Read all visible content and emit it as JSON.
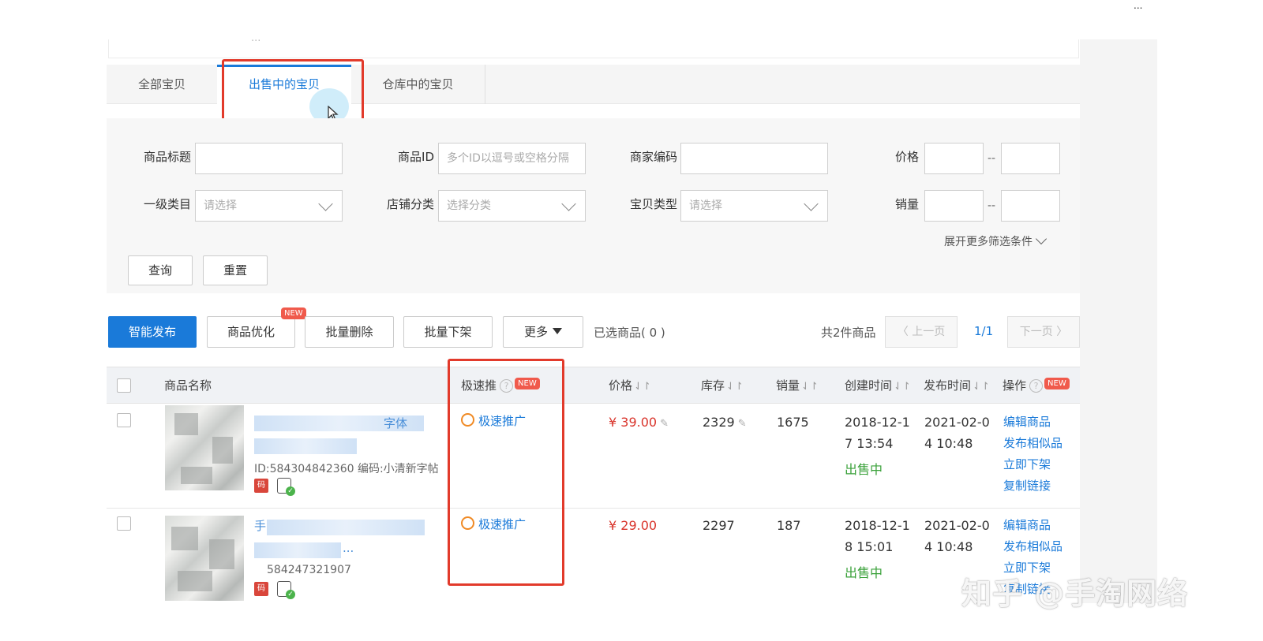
{
  "top": {
    "faint_text": "...",
    "corner_text": "..."
  },
  "tabs": [
    {
      "label": "全部宝贝"
    },
    {
      "label": "出售中的宝贝"
    },
    {
      "label": "仓库中的宝贝"
    }
  ],
  "filters": {
    "title_label": "商品标题",
    "id_label": "商品ID",
    "id_placeholder": "多个ID以逗号或空格分隔",
    "code_label": "商家编码",
    "price_label": "价格",
    "category_label": "一级类目",
    "category_value": "请选择",
    "shop_cat_label": "店铺分类",
    "shop_cat_value": "选择分类",
    "type_label": "宝贝类型",
    "type_value": "请选择",
    "sales_label": "销量",
    "range_sep": "--",
    "expand_label": "展开更多筛选条件",
    "query_button": "查询",
    "reset_button": "重置"
  },
  "toolbar": {
    "smart_publish": "智能发布",
    "optimize": "商品优化",
    "new_tag": "NEW",
    "batch_delete": "批量删除",
    "batch_offshelf": "批量下架",
    "more": "更多",
    "selected": "已选商品( 0 )",
    "total": "共2件商品",
    "prev": "上一页",
    "page": "1/1",
    "next": "下一页"
  },
  "table": {
    "headers": {
      "name": "商品名称",
      "promo": "极速推",
      "price": "价格",
      "stock": "库存",
      "sales": "销量",
      "created": "创建时间",
      "published": "发布时间",
      "ops": "操作",
      "new_tag": "NEW"
    },
    "rows": [
      {
        "title": "字体",
        "id_text": "ID:584304842360 编码:小清新字帖",
        "ma": "码",
        "promo": "极速推广",
        "price": "¥ 39.00",
        "stock": "2329",
        "sales": "1675",
        "created_1": "2018-12-1",
        "created_2": "7 13:54",
        "status": "出售中",
        "published_1": "2021-02-0",
        "published_2": "4 10:48",
        "ops": [
          "编辑商品",
          "发布相似品",
          "立即下架",
          "复制链接"
        ]
      },
      {
        "title": "手",
        "title_line2": "...",
        "id_text": "584247321907",
        "ma": "码",
        "promo": "极速推广",
        "price": "¥ 29.00",
        "stock": "2297",
        "sales": "187",
        "created_1": "2018-12-1",
        "created_2": "8 15:01",
        "status": "出售中",
        "published_1": "2021-02-0",
        "published_2": "4 10:48",
        "ops": [
          "编辑商品",
          "发布相似品",
          "立即下架",
          "复制链接"
        ]
      }
    ]
  },
  "watermark": "知乎 @手淘网络",
  "colors": {
    "accent": "#1a7ad9",
    "highlight": "#e23a2b",
    "price": "#d9342b",
    "status_ok": "#3aa13a"
  },
  "icons": {
    "cursor": "mouse-pointer-icon",
    "promo": "promo-circle-icon",
    "ma": "code-badge-icon",
    "phone": "mobile-check-icon",
    "help": "question-icon",
    "sort": "sort-icon",
    "edit": "pencil-icon"
  }
}
